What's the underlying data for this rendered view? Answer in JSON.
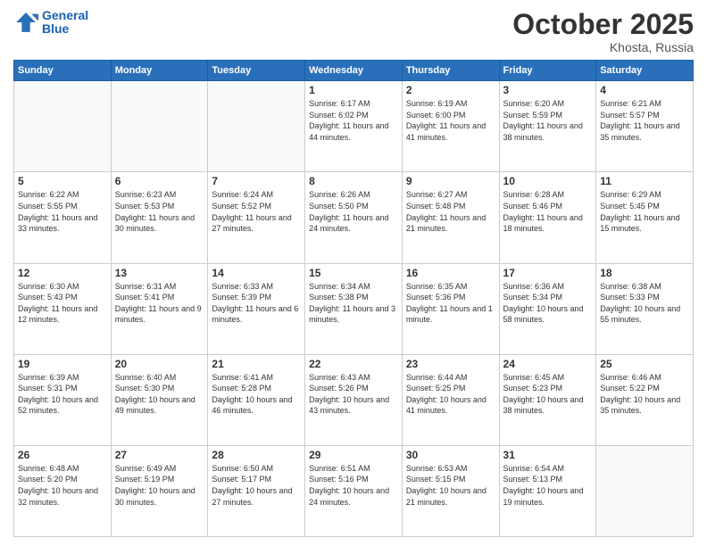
{
  "header": {
    "logo_line1": "General",
    "logo_line2": "Blue",
    "month": "October 2025",
    "location": "Khosta, Russia"
  },
  "weekdays": [
    "Sunday",
    "Monday",
    "Tuesday",
    "Wednesday",
    "Thursday",
    "Friday",
    "Saturday"
  ],
  "weeks": [
    [
      {
        "day": "",
        "sunrise": "",
        "sunset": "",
        "daylight": "",
        "empty": true
      },
      {
        "day": "",
        "sunrise": "",
        "sunset": "",
        "daylight": "",
        "empty": true
      },
      {
        "day": "",
        "sunrise": "",
        "sunset": "",
        "daylight": "",
        "empty": true
      },
      {
        "day": "1",
        "sunrise": "Sunrise: 6:17 AM",
        "sunset": "Sunset: 6:02 PM",
        "daylight": "Daylight: 11 hours and 44 minutes."
      },
      {
        "day": "2",
        "sunrise": "Sunrise: 6:19 AM",
        "sunset": "Sunset: 6:00 PM",
        "daylight": "Daylight: 11 hours and 41 minutes."
      },
      {
        "day": "3",
        "sunrise": "Sunrise: 6:20 AM",
        "sunset": "Sunset: 5:59 PM",
        "daylight": "Daylight: 11 hours and 38 minutes."
      },
      {
        "day": "4",
        "sunrise": "Sunrise: 6:21 AM",
        "sunset": "Sunset: 5:57 PM",
        "daylight": "Daylight: 11 hours and 35 minutes."
      }
    ],
    [
      {
        "day": "5",
        "sunrise": "Sunrise: 6:22 AM",
        "sunset": "Sunset: 5:55 PM",
        "daylight": "Daylight: 11 hours and 33 minutes."
      },
      {
        "day": "6",
        "sunrise": "Sunrise: 6:23 AM",
        "sunset": "Sunset: 5:53 PM",
        "daylight": "Daylight: 11 hours and 30 minutes."
      },
      {
        "day": "7",
        "sunrise": "Sunrise: 6:24 AM",
        "sunset": "Sunset: 5:52 PM",
        "daylight": "Daylight: 11 hours and 27 minutes."
      },
      {
        "day": "8",
        "sunrise": "Sunrise: 6:26 AM",
        "sunset": "Sunset: 5:50 PM",
        "daylight": "Daylight: 11 hours and 24 minutes."
      },
      {
        "day": "9",
        "sunrise": "Sunrise: 6:27 AM",
        "sunset": "Sunset: 5:48 PM",
        "daylight": "Daylight: 11 hours and 21 minutes."
      },
      {
        "day": "10",
        "sunrise": "Sunrise: 6:28 AM",
        "sunset": "Sunset: 5:46 PM",
        "daylight": "Daylight: 11 hours and 18 minutes."
      },
      {
        "day": "11",
        "sunrise": "Sunrise: 6:29 AM",
        "sunset": "Sunset: 5:45 PM",
        "daylight": "Daylight: 11 hours and 15 minutes."
      }
    ],
    [
      {
        "day": "12",
        "sunrise": "Sunrise: 6:30 AM",
        "sunset": "Sunset: 5:43 PM",
        "daylight": "Daylight: 11 hours and 12 minutes."
      },
      {
        "day": "13",
        "sunrise": "Sunrise: 6:31 AM",
        "sunset": "Sunset: 5:41 PM",
        "daylight": "Daylight: 11 hours and 9 minutes."
      },
      {
        "day": "14",
        "sunrise": "Sunrise: 6:33 AM",
        "sunset": "Sunset: 5:39 PM",
        "daylight": "Daylight: 11 hours and 6 minutes."
      },
      {
        "day": "15",
        "sunrise": "Sunrise: 6:34 AM",
        "sunset": "Sunset: 5:38 PM",
        "daylight": "Daylight: 11 hours and 3 minutes."
      },
      {
        "day": "16",
        "sunrise": "Sunrise: 6:35 AM",
        "sunset": "Sunset: 5:36 PM",
        "daylight": "Daylight: 11 hours and 1 minute."
      },
      {
        "day": "17",
        "sunrise": "Sunrise: 6:36 AM",
        "sunset": "Sunset: 5:34 PM",
        "daylight": "Daylight: 10 hours and 58 minutes."
      },
      {
        "day": "18",
        "sunrise": "Sunrise: 6:38 AM",
        "sunset": "Sunset: 5:33 PM",
        "daylight": "Daylight: 10 hours and 55 minutes."
      }
    ],
    [
      {
        "day": "19",
        "sunrise": "Sunrise: 6:39 AM",
        "sunset": "Sunset: 5:31 PM",
        "daylight": "Daylight: 10 hours and 52 minutes."
      },
      {
        "day": "20",
        "sunrise": "Sunrise: 6:40 AM",
        "sunset": "Sunset: 5:30 PM",
        "daylight": "Daylight: 10 hours and 49 minutes."
      },
      {
        "day": "21",
        "sunrise": "Sunrise: 6:41 AM",
        "sunset": "Sunset: 5:28 PM",
        "daylight": "Daylight: 10 hours and 46 minutes."
      },
      {
        "day": "22",
        "sunrise": "Sunrise: 6:43 AM",
        "sunset": "Sunset: 5:26 PM",
        "daylight": "Daylight: 10 hours and 43 minutes."
      },
      {
        "day": "23",
        "sunrise": "Sunrise: 6:44 AM",
        "sunset": "Sunset: 5:25 PM",
        "daylight": "Daylight: 10 hours and 41 minutes."
      },
      {
        "day": "24",
        "sunrise": "Sunrise: 6:45 AM",
        "sunset": "Sunset: 5:23 PM",
        "daylight": "Daylight: 10 hours and 38 minutes."
      },
      {
        "day": "25",
        "sunrise": "Sunrise: 6:46 AM",
        "sunset": "Sunset: 5:22 PM",
        "daylight": "Daylight: 10 hours and 35 minutes."
      }
    ],
    [
      {
        "day": "26",
        "sunrise": "Sunrise: 6:48 AM",
        "sunset": "Sunset: 5:20 PM",
        "daylight": "Daylight: 10 hours and 32 minutes."
      },
      {
        "day": "27",
        "sunrise": "Sunrise: 6:49 AM",
        "sunset": "Sunset: 5:19 PM",
        "daylight": "Daylight: 10 hours and 30 minutes."
      },
      {
        "day": "28",
        "sunrise": "Sunrise: 6:50 AM",
        "sunset": "Sunset: 5:17 PM",
        "daylight": "Daylight: 10 hours and 27 minutes."
      },
      {
        "day": "29",
        "sunrise": "Sunrise: 6:51 AM",
        "sunset": "Sunset: 5:16 PM",
        "daylight": "Daylight: 10 hours and 24 minutes."
      },
      {
        "day": "30",
        "sunrise": "Sunrise: 6:53 AM",
        "sunset": "Sunset: 5:15 PM",
        "daylight": "Daylight: 10 hours and 21 minutes."
      },
      {
        "day": "31",
        "sunrise": "Sunrise: 6:54 AM",
        "sunset": "Sunset: 5:13 PM",
        "daylight": "Daylight: 10 hours and 19 minutes."
      },
      {
        "day": "",
        "sunrise": "",
        "sunset": "",
        "daylight": "",
        "empty": true
      }
    ]
  ]
}
